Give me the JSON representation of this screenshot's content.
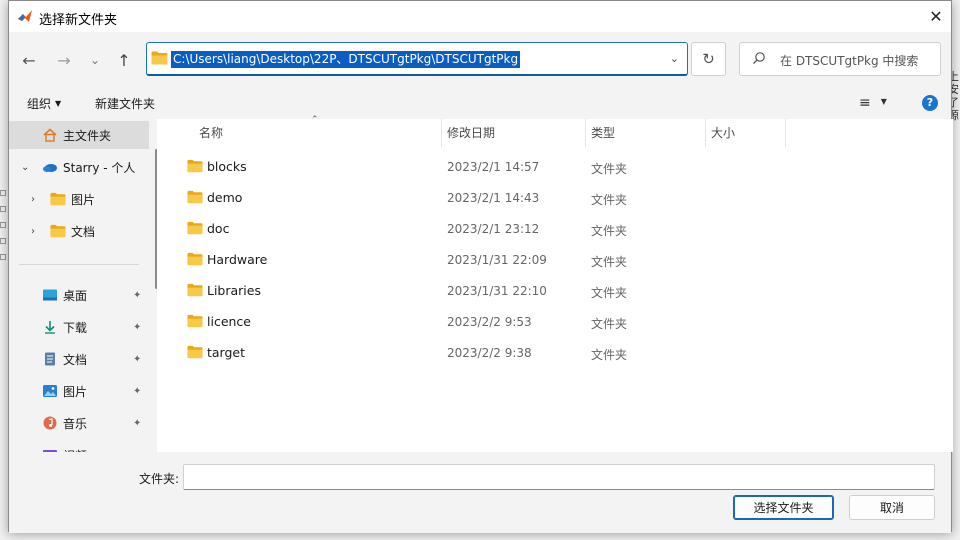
{
  "dialog": {
    "title": "选择新文件夹",
    "close_glyph": "✕"
  },
  "nav": {
    "back_glyph": "←",
    "forward_glyph": "→",
    "recent_glyph": "⌄",
    "up_glyph": "↑",
    "address_path": "C:\\Users\\liang\\Desktop\\22P、DTSCUTgtPkg\\DTSCUTgtPkg",
    "address_dropdown_glyph": "⌄",
    "refresh_glyph": "↻",
    "search_placeholder": "在 DTSCUTgtPkg 中搜索"
  },
  "toolbar": {
    "organize_label": "组织",
    "organize_arrow": "▼",
    "new_folder_label": "新建文件夹",
    "view_glyph": "≡",
    "view_arrow": "▼",
    "help_glyph": "?"
  },
  "sidebar": {
    "items": [
      {
        "label": "主文件夹",
        "icon": "home-icon",
        "chevron": "",
        "pin": ""
      },
      {
        "label": "Starry - 个人",
        "icon": "cloud-icon",
        "chevron": "⌄",
        "pin": ""
      },
      {
        "label": "图片",
        "icon": "folder-icon",
        "chevron": "›",
        "pin": ""
      },
      {
        "label": "文档",
        "icon": "folder-icon",
        "chevron": "›",
        "pin": ""
      },
      {
        "label": "桌面",
        "icon": "desktop-icon",
        "chevron": "",
        "pin": "📌"
      },
      {
        "label": "下载",
        "icon": "download-icon",
        "chevron": "",
        "pin": "📌"
      },
      {
        "label": "文档",
        "icon": "document-icon",
        "chevron": "",
        "pin": "📌"
      },
      {
        "label": "图片",
        "icon": "picture-icon",
        "chevron": "",
        "pin": "📌"
      },
      {
        "label": "音乐",
        "icon": "music-icon",
        "chevron": "",
        "pin": "📌"
      },
      {
        "label": "视频",
        "icon": "video-icon",
        "chevron": "",
        "pin": ""
      }
    ]
  },
  "file_list": {
    "columns": [
      "名称",
      "修改日期",
      "类型",
      "大小"
    ],
    "sort_glyph": "⌃",
    "rows": [
      {
        "name": "blocks",
        "date": "2023/2/1 14:57",
        "type": "文件夹"
      },
      {
        "name": "demo",
        "date": "2023/2/1 14:43",
        "type": "文件夹"
      },
      {
        "name": "doc",
        "date": "2023/2/1 23:12",
        "type": "文件夹"
      },
      {
        "name": "Hardware",
        "date": "2023/1/31 22:09",
        "type": "文件夹"
      },
      {
        "name": "Libraries",
        "date": "2023/1/31 22:10",
        "type": "文件夹"
      },
      {
        "name": "licence",
        "date": "2023/2/2 9:53",
        "type": "文件夹"
      },
      {
        "name": "target",
        "date": "2023/2/2 9:38",
        "type": "文件夹"
      }
    ]
  },
  "footer": {
    "folder_label": "文件夹:",
    "folder_value": "",
    "select_button": "选择文件夹",
    "cancel_button": "取消"
  },
  "background": {
    "right_edge_text": "上\n安\n了\n源"
  },
  "colors": {
    "accent": "#0a5dc2",
    "folder_yellow": "#f7c948",
    "help_blue": "#1a75d2"
  }
}
